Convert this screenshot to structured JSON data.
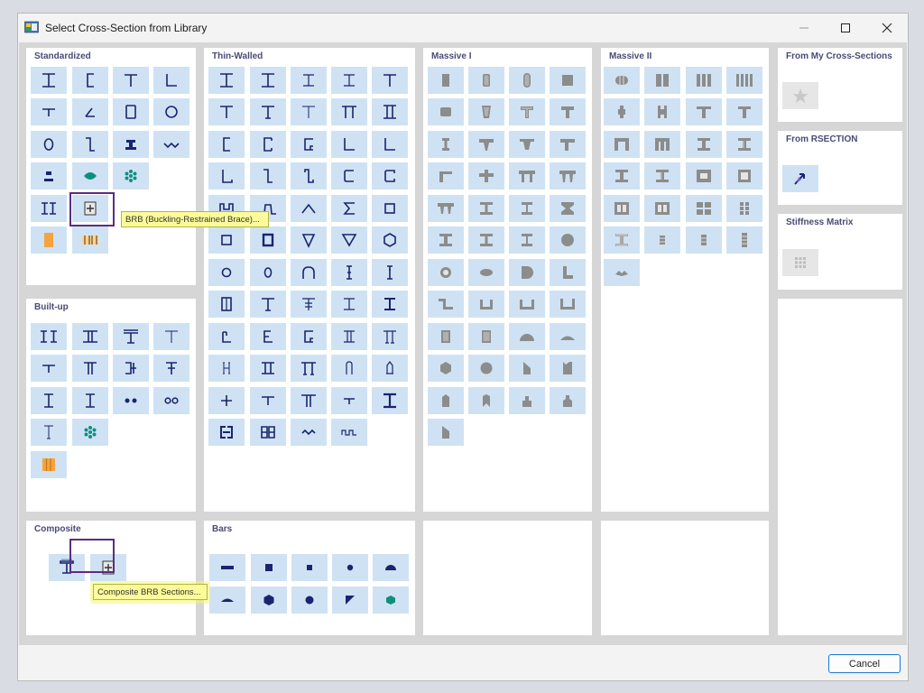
{
  "window": {
    "title": "Select Cross-Section from Library",
    "minimize_icon": "minimize-icon",
    "maximize_icon": "maximize-icon",
    "close_icon": "close-icon"
  },
  "panels": {
    "standardized": {
      "title": "Standardized"
    },
    "thin_walled": {
      "title": "Thin-Walled"
    },
    "massive_1": {
      "title": "Massive I"
    },
    "massive_2": {
      "title": "Massive II"
    },
    "my_sections": {
      "title": "From My Cross-Sections"
    },
    "rsection": {
      "title": "From RSECTION"
    },
    "stiffness": {
      "title": "Stiffness Matrix"
    },
    "built_up": {
      "title": "Built-up"
    },
    "composite": {
      "title": "Composite"
    },
    "bars": {
      "title": "Bars"
    }
  },
  "tooltips": {
    "brb": "BRB (Buckling-Restrained Brace)...",
    "composite_brb": "Composite BRB Sections..."
  },
  "buttons": {
    "cancel": "Cancel"
  },
  "colors": {
    "button_bg": "#cfe2f3",
    "icon_navy": "#1a2470",
    "icon_gray": "#8c8c8c",
    "accent_teal": "#0e8f7e",
    "accent_orange": "#f4a340",
    "highlight_purple": "#5c2d7e",
    "tooltip_yellow": "#fbfb99"
  }
}
